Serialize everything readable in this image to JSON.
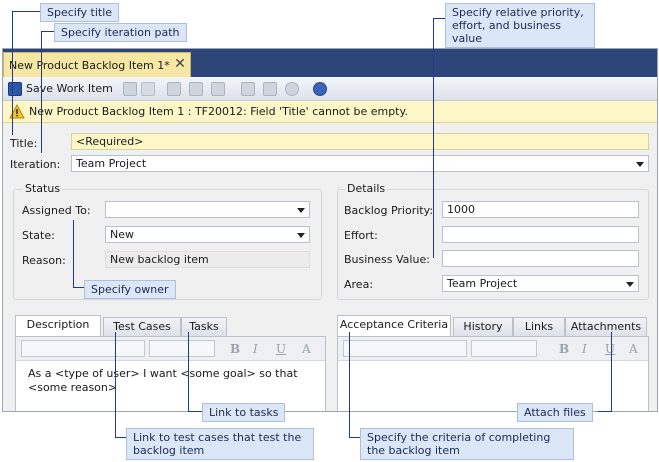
{
  "window": {
    "tab_title": "New Product Backlog Item 1*",
    "close_glyph": "✕"
  },
  "toolbar": {
    "save_label": "Save Work Item",
    "icons": [
      "save-icon",
      "copy-icon",
      "undo-icon",
      "link-icon",
      "copy-item-icon",
      "attach-icon",
      "query-icon",
      "email-icon",
      "refresh-icon",
      "help-icon"
    ]
  },
  "infobar": {
    "message": "New Product Backlog Item 1 : TF20012: Field 'Title' cannot be empty."
  },
  "form": {
    "title_label": "Title:",
    "title_value": "<Required>",
    "iteration_label": "Iteration:",
    "iteration_value": "Team Project"
  },
  "status": {
    "heading": "Status",
    "assigned_label": "Assigned To:",
    "assigned_value": "",
    "state_label": "State:",
    "state_value": "New",
    "reason_label": "Reason:",
    "reason_value": "New backlog item"
  },
  "details": {
    "heading": "Details",
    "priority_label": "Backlog Priority:",
    "priority_value": "1000",
    "effort_label": "Effort:",
    "effort_value": "",
    "business_label": "Business Value:",
    "business_value": "",
    "area_label": "Area:",
    "area_value": "Team Project"
  },
  "left_tabs": [
    "Description",
    "Test Cases",
    "Tasks"
  ],
  "right_tabs": [
    "Acceptance Criteria",
    "History",
    "Links",
    "Attachments"
  ],
  "description_text": "As a <type of user> I want <some goal> so that <some reason>",
  "rich_text_buttons": [
    "B",
    "I",
    "U",
    "A"
  ],
  "callouts": {
    "title": "Specify title",
    "iteration": "Specify iteration path",
    "priority": "Specify relative priority, effort, and business value",
    "owner": "Specify owner",
    "tasks": "Link to tasks",
    "attach": "Attach files",
    "test_cases": "Link to test cases that test the backlog item",
    "criteria": "Specify the criteria of completing the backlog item"
  },
  "colors": {
    "tab_strip": "#2d4579",
    "doc_tab": "#f6e7a4",
    "infobar": "#fdf7c8",
    "callout_bg": "#dbe6f7",
    "callout_line": "#223a8a"
  }
}
